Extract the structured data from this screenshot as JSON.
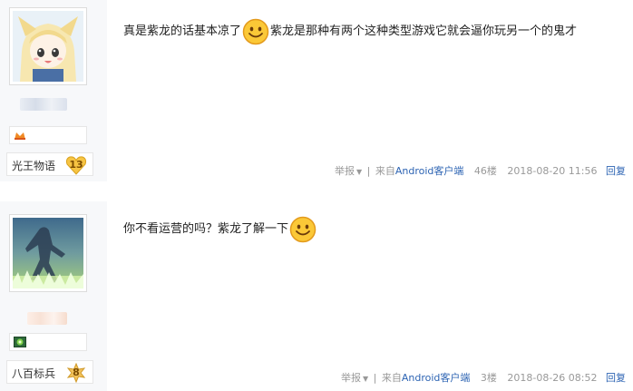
{
  "posts": [
    {
      "forum_badge": "光王物语",
      "badge_level": "13",
      "text_before": "真是紫龙的话基本凉了",
      "text_after": "紫龙是那种有两个这种类型游戏它就会逼你玩另一个的鬼才",
      "report_label": "举报",
      "source_prefix": "来自",
      "source_client": "Android客户端",
      "floor": "46楼",
      "time": "2018-08-20 11:56",
      "reply_label": "回复"
    },
    {
      "forum_badge": "八百标兵",
      "badge_level": "8",
      "text_before": "你不看运营的吗？紫龙了解一下",
      "text_after": "",
      "report_label": "举报",
      "source_prefix": "来自",
      "source_client": "Android客户端",
      "floor": "3楼",
      "time": "2018-08-26 08:52",
      "reply_label": "回复"
    }
  ],
  "colors": {
    "sidebar_bg": "#f7f8fa",
    "link_blue": "#2d64b3",
    "meta_gray": "#999999",
    "badge_gold": "#f6c443"
  },
  "icons": {
    "emoji": "smiley-face-icon",
    "level": "level-icon",
    "badge": "gold-heart-badge-icon"
  }
}
